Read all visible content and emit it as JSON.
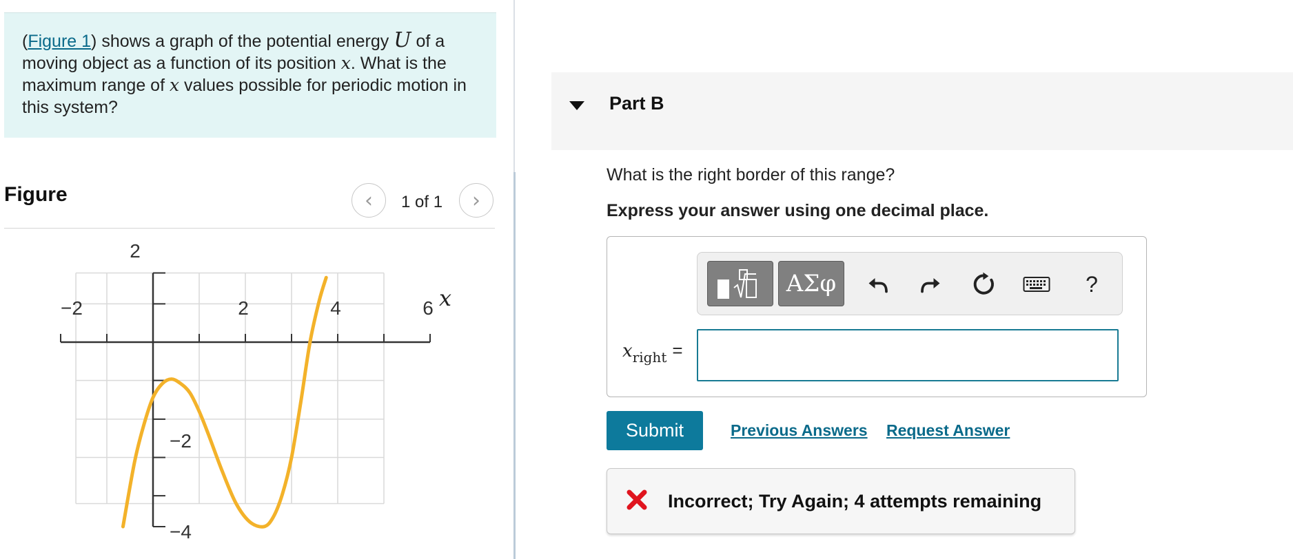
{
  "problem": {
    "link_text": "Figure 1",
    "seg1": ") shows a graph of the potential energy ",
    "var_U": "U",
    "seg2": " of a moving object as a function of its position ",
    "var_x1": "x",
    "seg3": ". What is the maximum range of ",
    "var_x2": "x",
    "seg4": " values possible for periodic motion in this system?"
  },
  "figure": {
    "title": "Figure",
    "counter": "1 of 1",
    "prev_glyph": "‹",
    "next_glyph": "›"
  },
  "chart_data": {
    "type": "line",
    "xlabel": "x",
    "ylabel": "",
    "xlim": [
      -2,
      6
    ],
    "ylim": [
      -4,
      2
    ],
    "x_tick_labels": [
      "−2",
      "2",
      "4",
      "6"
    ],
    "y_tick_labels": [
      "2",
      "−2",
      "−4"
    ],
    "grid": true,
    "curve_color": "#f3b22a",
    "series": [
      {
        "x": [
          -0.65,
          -0.4,
          -0.2,
          0.0,
          0.2,
          0.4,
          0.6,
          0.8,
          1.0,
          1.2,
          1.5,
          1.8,
          2.1,
          2.4,
          2.6,
          2.8,
          3.0,
          3.2,
          3.4,
          3.6,
          3.75
        ],
        "values": [
          -4.0,
          -2.6,
          -1.8,
          -1.2,
          -0.9,
          -0.8,
          -0.9,
          -1.1,
          -1.5,
          -2.0,
          -2.8,
          -3.5,
          -3.9,
          -4.0,
          -3.8,
          -3.3,
          -2.5,
          -1.3,
          0.0,
          0.9,
          1.4
        ]
      }
    ]
  },
  "part": {
    "title": "Part B",
    "question": "What is the right border of this range?",
    "instruction": "Express your answer using one decimal place."
  },
  "answer": {
    "variable": "x",
    "subscript": "right",
    "equals": "=",
    "value": "",
    "symbols_label": "ΑΣφ",
    "help_label": "?"
  },
  "actions": {
    "submit": "Submit",
    "previous_answers": "Previous Answers",
    "request_answer": "Request Answer"
  },
  "feedback": {
    "text": "Incorrect; Try Again; 4 attempts remaining",
    "color": "#e0141e"
  }
}
